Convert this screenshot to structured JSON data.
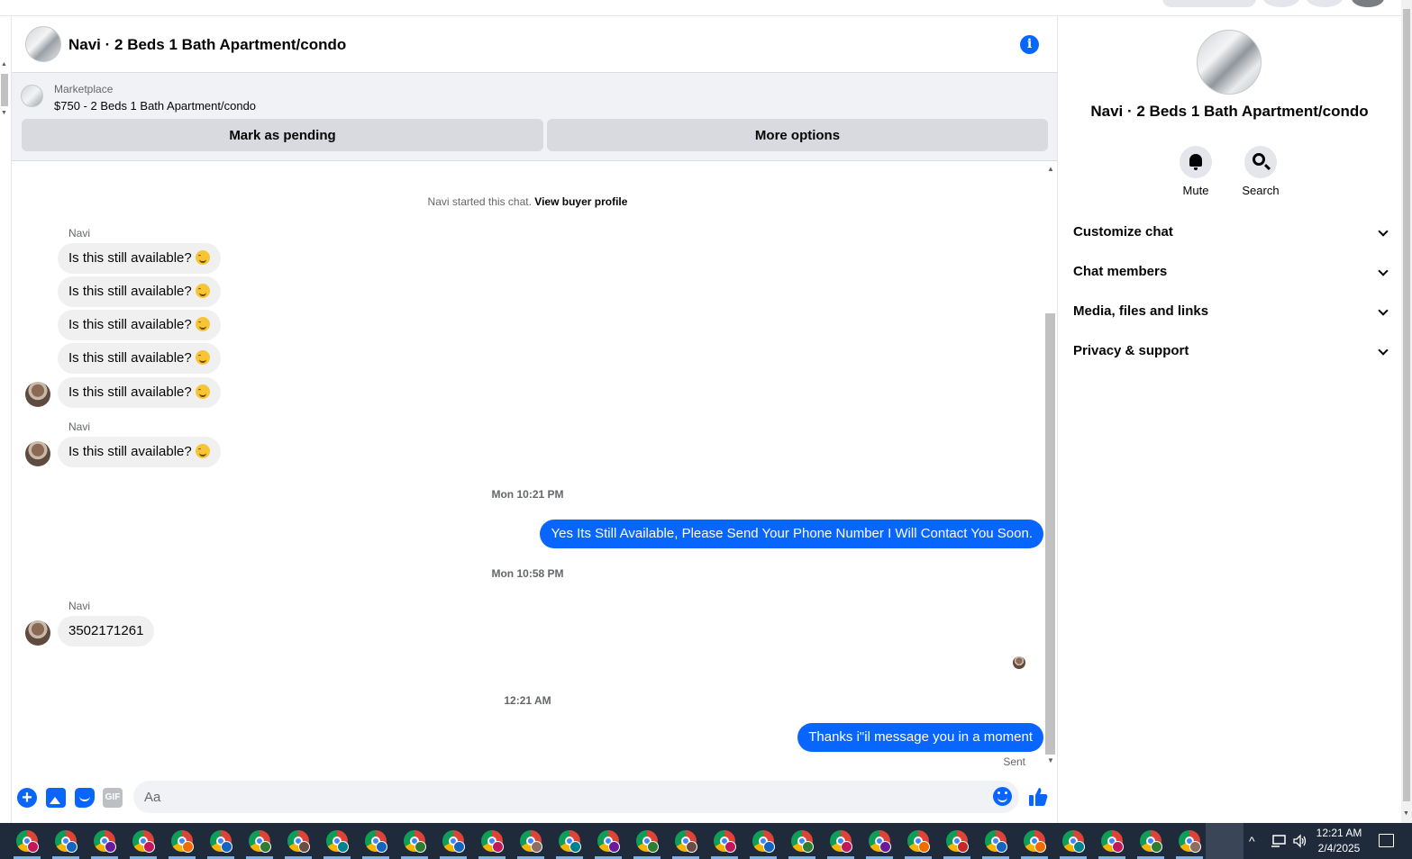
{
  "chat": {
    "title": "Navi · 2 Beds 1 Bath Apartment/condo",
    "marketplace_label": "Marketplace",
    "listing": "$750 - 2 Beds 1 Bath Apartment/condo",
    "mark_pending": "Mark as pending",
    "more_options": "More options"
  },
  "thread": {
    "started_prefix": "Navi started this chat.",
    "view_profile": "View buyer profile",
    "sender_name": "Navi",
    "incoming_repeat": "Is this still available?",
    "time_1": "Mon 10:21 PM",
    "outgoing_1": "Yes Its Still Available, Please Send Your Phone Number I Will Contact You Soon.",
    "time_2": "Mon 10:58 PM",
    "incoming_phone": "3502171261",
    "time_3": "12:21 AM",
    "outgoing_2": "Thanks i\"il message you in a moment",
    "sent_status": "Sent"
  },
  "composer": {
    "placeholder": "Aa",
    "gif_label": "GIF"
  },
  "details": {
    "title": "Navi · 2 Beds 1 Bath Apartment/condo",
    "mute": "Mute",
    "search": "Search",
    "sections": [
      "Customize chat",
      "Chat members",
      "Media, files and links",
      "Privacy & support"
    ]
  },
  "taskbar": {
    "time": "12:21 AM",
    "date": "2/4/2025"
  },
  "colors": {
    "accent": "#0866ff",
    "bubble_in": "#f0f0f0",
    "taskbar": "#1f2a3a"
  },
  "icons": [
    "info-icon",
    "plus-icon",
    "image-icon",
    "sticker-icon",
    "gif-icon",
    "emoji-icon",
    "like-icon",
    "bell-icon",
    "search-icon",
    "chevron-down-icon",
    "chrome-icon"
  ]
}
